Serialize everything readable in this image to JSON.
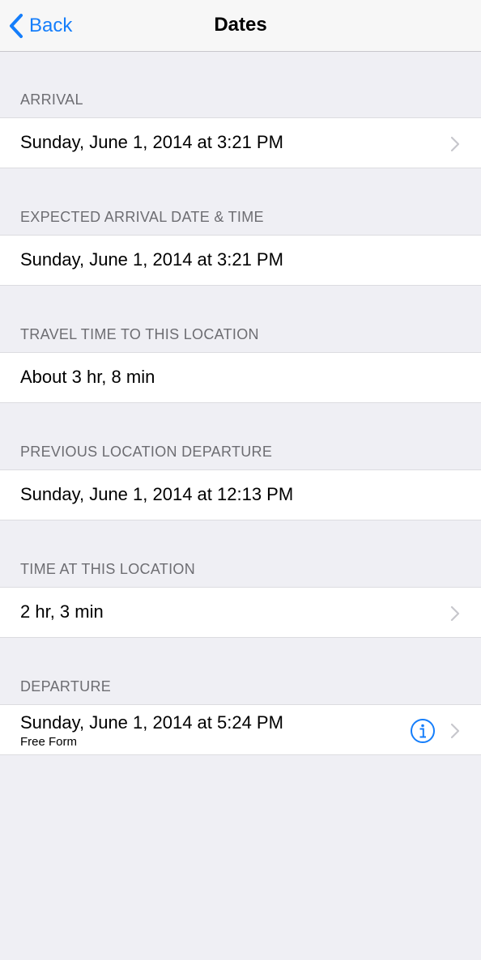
{
  "nav": {
    "back_label": "Back",
    "title": "Dates"
  },
  "sections": [
    {
      "header": "ARRIVAL",
      "value": "Sunday, June 1, 2014 at 3:21 PM",
      "chevron": true
    },
    {
      "header": "EXPECTED ARRIVAL DATE & TIME",
      "value": "Sunday, June 1, 2014 at 3:21 PM",
      "chevron": false
    },
    {
      "header": "TRAVEL TIME TO THIS LOCATION",
      "value": "About 3 hr, 8 min",
      "chevron": false
    },
    {
      "header": "PREVIOUS LOCATION DEPARTURE",
      "value": "Sunday, June 1, 2014 at 12:13 PM",
      "chevron": false
    },
    {
      "header": "TIME AT THIS LOCATION",
      "value": "2 hr, 3 min",
      "chevron": true
    },
    {
      "header": "DEPARTURE",
      "value": "Sunday, June 1, 2014 at 5:24 PM",
      "subtitle": "Free Form",
      "chevron": true,
      "info_icon": "info-icon"
    }
  ],
  "colors": {
    "accent": "#157efb",
    "background": "#efeff4",
    "header_text": "#6d6d72",
    "chevron": "#c7c7cc"
  }
}
